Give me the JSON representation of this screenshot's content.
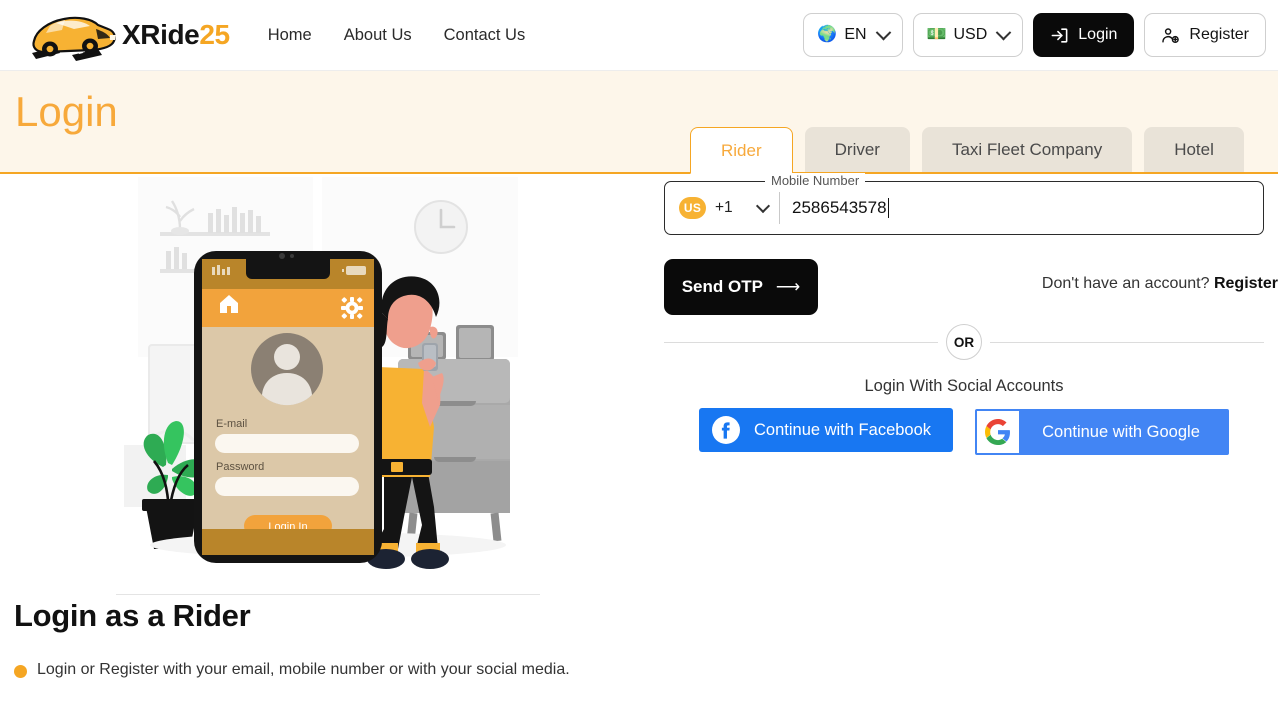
{
  "header": {
    "brand_main": "XRide",
    "brand_num": "25",
    "logo_icon": "car-logo-icon",
    "nav": [
      {
        "label": "Home"
      },
      {
        "label": "About Us"
      },
      {
        "label": "Contact Us"
      }
    ],
    "language": {
      "label": "EN",
      "icon": "globe-icon",
      "chevron": "chevron-down-icon"
    },
    "currency": {
      "label": "USD",
      "icon": "money-icon",
      "chevron": "chevron-down-icon"
    },
    "login": {
      "label": "Login",
      "icon": "sign-in-icon"
    },
    "register": {
      "label": "Register",
      "icon": "user-plus-icon"
    }
  },
  "banner": {
    "title": "Login",
    "title_color": "#f7a93b",
    "background": "#fdf6ea",
    "border_color": "#f5a623",
    "tabs": [
      {
        "label": "Rider",
        "active": true
      },
      {
        "label": "Driver",
        "active": false
      },
      {
        "label": "Taxi Fleet Company",
        "active": false
      },
      {
        "label": "Hotel",
        "active": false
      }
    ]
  },
  "illustration": {
    "name": "login-illustration",
    "phone_screen": {
      "email_label": "E-mail",
      "password_label": "Password",
      "button_label": "Login In",
      "status_bar": "lte",
      "home_icon": "home-icon",
      "gear_icon": "gear-icon"
    }
  },
  "left": {
    "heading": "Login as a Rider",
    "bullet": "Login or Register with your email, mobile number or with your social media."
  },
  "form": {
    "legend": "Mobile Number",
    "country_badge": "US",
    "country_code": "+1",
    "phone_value": "2586543578",
    "phone_placeholder": "Mobile Number",
    "send_otp_label": "Send OTP",
    "send_otp_arrow": "arrow-right-icon",
    "no_account_text": "Don't have an account? ",
    "register_link": "Register",
    "or_label": "OR",
    "social_label": "Login With Social Accounts",
    "facebook_label": "Continue with Facebook",
    "google_label": "Continue with Google",
    "facebook_color": "#1877f2",
    "google_color": "#4285f4"
  }
}
